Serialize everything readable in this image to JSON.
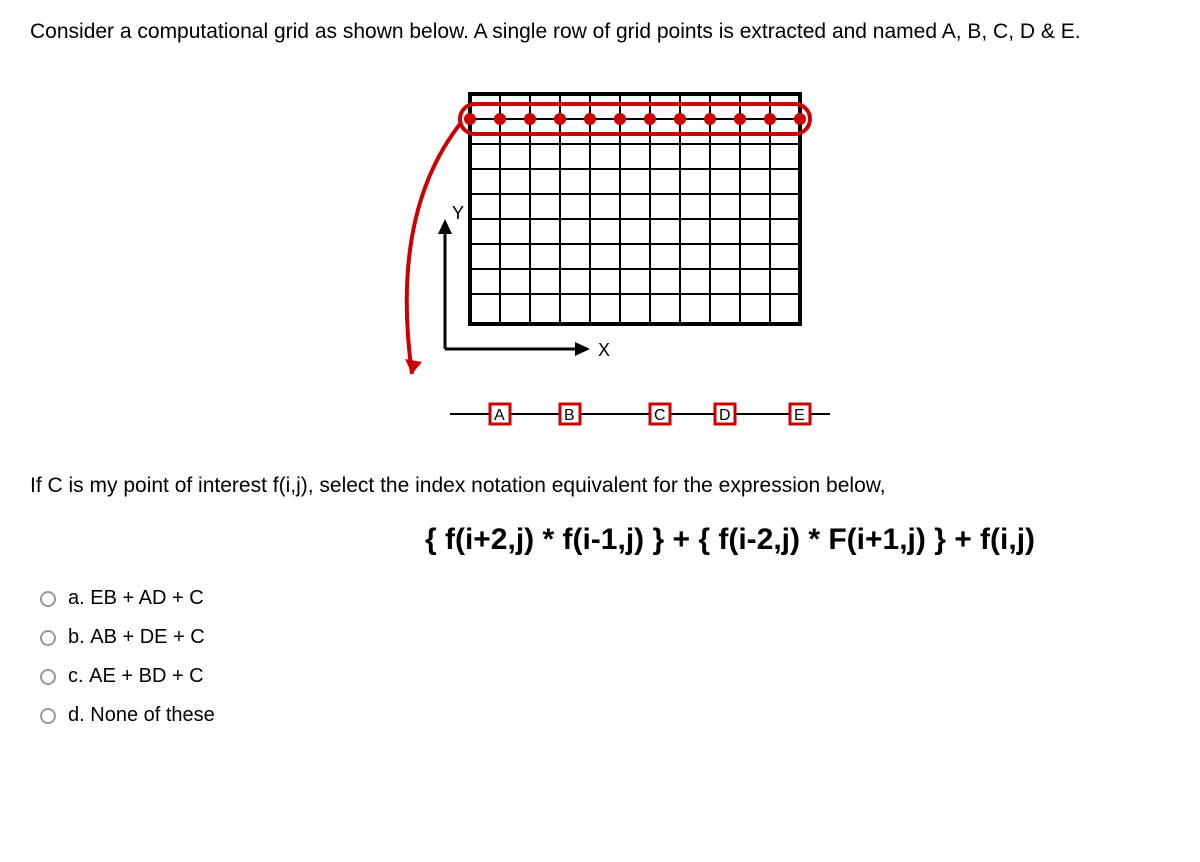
{
  "question": {
    "intro": "Consider a computational grid as shown below. A single row of grid points is extracted and named A, B, C, D & E.",
    "prompt": "If C is my point of interest f(i,j), select the index notation equivalent for the expression below,",
    "expression": "{ f(i+2,j) * f(i-1,j) } + { f(i-2,j) * F(i+1,j) } + f(i,j)"
  },
  "diagram": {
    "axis_y": "Y",
    "axis_x": "X",
    "labels": [
      "A",
      "B",
      "C",
      "D",
      "E"
    ]
  },
  "options": [
    {
      "letter": "a.",
      "text": "EB + AD + C"
    },
    {
      "letter": "b.",
      "text": "AB + DE + C"
    },
    {
      "letter": "c.",
      "text": "AE + BD + C"
    },
    {
      "letter": "d.",
      "text": "None of these"
    }
  ]
}
